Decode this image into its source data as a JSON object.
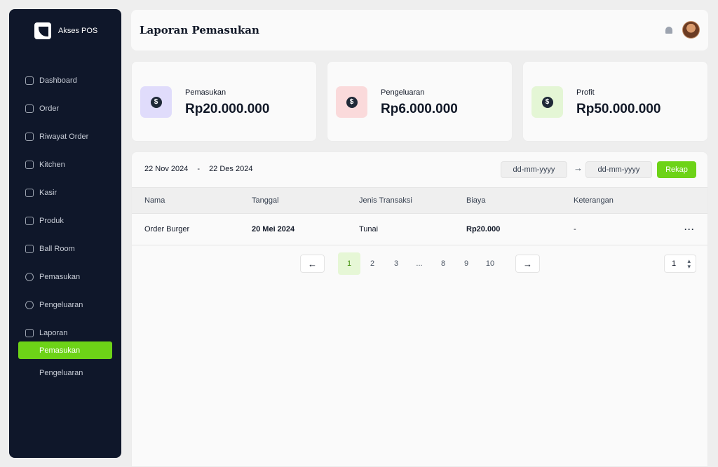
{
  "app": {
    "brand": "Akses POS"
  },
  "sidebar": {
    "items": [
      {
        "label": "Dashboard",
        "icon": "home-icon"
      },
      {
        "label": "Order",
        "icon": "cart-icon"
      },
      {
        "label": "Riwayat Order",
        "icon": "history-icon"
      },
      {
        "label": "Kitchen",
        "icon": "kitchen-icon"
      },
      {
        "label": "Kasir",
        "icon": "cashier-icon"
      },
      {
        "label": "Produk",
        "icon": "product-icon"
      },
      {
        "label": "Ball Room",
        "icon": "calendar-icon"
      },
      {
        "label": "Pemasukan",
        "icon": "income-icon"
      },
      {
        "label": "Pengeluaran",
        "icon": "expense-icon"
      },
      {
        "label": "Laporan",
        "icon": "report-icon"
      }
    ],
    "sub_items": [
      {
        "label": "Pemasukan",
        "active": true
      },
      {
        "label": "Pengeluaran",
        "active": false
      }
    ]
  },
  "header": {
    "title": "Laporan Pemasukan"
  },
  "cards": [
    {
      "label": "Pemasukan",
      "value": "Rp20.000.000",
      "icon_bg": "#e0dcfb",
      "icon": "income-coin-icon"
    },
    {
      "label": "Pengeluaran",
      "value": "Rp6.000.000",
      "icon_bg": "#fadadb",
      "icon": "expense-coin-icon"
    },
    {
      "label": "Profit",
      "value": "Rp50.000.000",
      "icon_bg": "#e4f6d5",
      "icon": "dollar-coin-icon"
    }
  ],
  "filter": {
    "start": "22 Nov 2024",
    "separator": "-",
    "end": "22 Des 2024",
    "from_placeholder": "dd-mm-yyyy",
    "arrow": "→",
    "to_placeholder": "dd-mm-yyyy",
    "rekap_label": "Rekap"
  },
  "table": {
    "columns": [
      "Nama",
      "Tanggal",
      "Jenis Transaksi",
      "Biaya",
      "Keterangan"
    ],
    "rows": [
      {
        "nama": "Order Burger",
        "tanggal": "20 Mei 2024",
        "jenis": "Tunai",
        "biaya": "Rp20.000",
        "keterangan": "-",
        "more": "···"
      }
    ]
  },
  "pagination": {
    "prev": "←",
    "next": "→",
    "pages": [
      "1",
      "2",
      "3",
      "...",
      "8",
      "9",
      "10"
    ],
    "current": "1",
    "per_page": "1"
  },
  "colors": {
    "accent": "#6dd317",
    "sidebar": "#0f172a"
  }
}
